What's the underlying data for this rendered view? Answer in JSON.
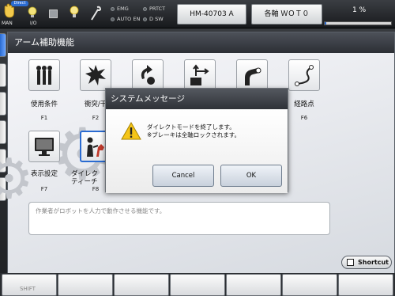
{
  "topbar": {
    "mode_man": "MAN",
    "mode_direct": "Direct",
    "mode_io": "I/O",
    "indicators": [
      "EMG",
      "PRTCT",
      "AUTO EN",
      "D SW"
    ],
    "robot_model": "HM-40703 A",
    "axis_mode": "各軸 ＷＯＴ０",
    "speed": "1 %",
    "speed_level": 0.01
  },
  "panel": {
    "title": "アーム補助機能",
    "functions": [
      {
        "label": "使用条件",
        "key": "F1",
        "icon": "control-sticks-icon"
      },
      {
        "label": "衝突/干",
        "key": "F2",
        "icon": "collision-icon"
      },
      {
        "label": "",
        "key": "",
        "icon": "rotation-icon"
      },
      {
        "label": "",
        "key": "",
        "icon": "axis-icon"
      },
      {
        "label": "",
        "key": "",
        "icon": "arm-icon"
      },
      {
        "label": "経路点",
        "key": "F6",
        "icon": "path-icon"
      },
      {
        "label": "表示設定",
        "key": "F7",
        "icon": "monitor-icon"
      },
      {
        "label": "ダイレク\nティーチ",
        "key": "F8",
        "icon": "direct-teach-icon"
      }
    ],
    "description": "作業者がロボットを人力で動作させる機能です。"
  },
  "dialog": {
    "title": "システムメッセージ",
    "message_line1": "ダイレクトモードを終了します。",
    "message_line2": "※ブレーキは全軸ロックされます。",
    "cancel_label": "Cancel",
    "ok_label": "OK"
  },
  "bottom": {
    "shortcut_label": "Shortcut",
    "fkey_labels": [
      "SHIFT",
      "",
      "",
      "",
      "",
      "",
      ""
    ]
  },
  "colors": {
    "accent": "#2a6bd1",
    "titlebar": "#3a3d43"
  }
}
